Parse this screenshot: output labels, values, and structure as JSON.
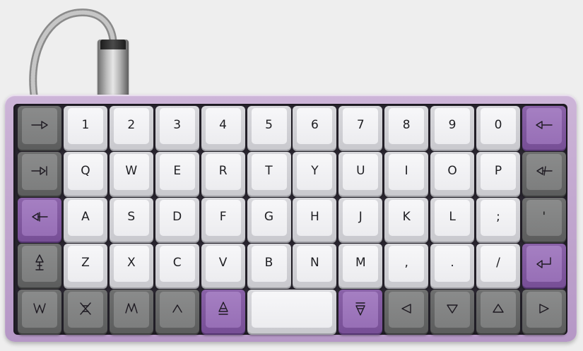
{
  "colors": {
    "case": "#c3a9d0",
    "alpha_keys": "#f2f2f4",
    "mod_keys": "#828383",
    "accent_keys": "#9c74ba",
    "cable": "#a8a8a8"
  },
  "keyboard": {
    "rows": [
      [
        {
          "label": "",
          "icon": "tab-right-arrow-icon",
          "color": "gray"
        },
        {
          "label": "1",
          "color": "white"
        },
        {
          "label": "2",
          "color": "white"
        },
        {
          "label": "3",
          "color": "white"
        },
        {
          "label": "4",
          "color": "white"
        },
        {
          "label": "5",
          "color": "white"
        },
        {
          "label": "6",
          "color": "white"
        },
        {
          "label": "7",
          "color": "white"
        },
        {
          "label": "8",
          "color": "white"
        },
        {
          "label": "9",
          "color": "white"
        },
        {
          "label": "0",
          "color": "white"
        },
        {
          "label": "",
          "icon": "backspace-arrow-icon",
          "color": "purple"
        }
      ],
      [
        {
          "label": "",
          "icon": "tab-key-icon",
          "color": "gray"
        },
        {
          "label": "Q",
          "color": "white"
        },
        {
          "label": "W",
          "color": "white"
        },
        {
          "label": "E",
          "color": "white"
        },
        {
          "label": "R",
          "color": "white"
        },
        {
          "label": "T",
          "color": "white"
        },
        {
          "label": "Y",
          "color": "white"
        },
        {
          "label": "U",
          "color": "white"
        },
        {
          "label": "I",
          "color": "white"
        },
        {
          "label": "O",
          "color": "white"
        },
        {
          "label": "P",
          "color": "white"
        },
        {
          "label": "",
          "icon": "delete-arrow-icon",
          "color": "gray"
        }
      ],
      [
        {
          "label": "",
          "icon": "escape-arrow-icon",
          "color": "purple"
        },
        {
          "label": "A",
          "color": "white"
        },
        {
          "label": "S",
          "color": "white"
        },
        {
          "label": "D",
          "color": "white"
        },
        {
          "label": "F",
          "color": "white"
        },
        {
          "label": "G",
          "color": "white"
        },
        {
          "label": "H",
          "color": "white"
        },
        {
          "label": "J",
          "color": "white"
        },
        {
          "label": "K",
          "color": "white"
        },
        {
          "label": "L",
          "color": "white"
        },
        {
          "label": ";",
          "color": "white"
        },
        {
          "label": "'",
          "color": "gray"
        }
      ],
      [
        {
          "label": "",
          "icon": "shift-arrow-icon",
          "color": "gray"
        },
        {
          "label": "Z",
          "color": "white"
        },
        {
          "label": "X",
          "color": "white"
        },
        {
          "label": "C",
          "color": "white"
        },
        {
          "label": "V",
          "color": "white"
        },
        {
          "label": "B",
          "color": "white"
        },
        {
          "label": "N",
          "color": "white"
        },
        {
          "label": "M",
          "color": "white"
        },
        {
          "label": ",",
          "color": "white"
        },
        {
          "label": ".",
          "color": "white"
        },
        {
          "label": "/",
          "color": "white"
        },
        {
          "label": "",
          "icon": "enter-arrow-icon",
          "color": "purple"
        }
      ]
    ],
    "bottom_row": [
      {
        "label": "",
        "icon": "control-caret-icon",
        "color": "gray",
        "span": 1
      },
      {
        "label": "",
        "icon": "alt-double-caret-icon",
        "color": "gray",
        "span": 1
      },
      {
        "label": "",
        "icon": "gui-caret-icon",
        "color": "gray",
        "span": 1
      },
      {
        "label": "",
        "icon": "caret-up-icon",
        "color": "gray",
        "span": 1
      },
      {
        "label": "",
        "icon": "raise-triangle-icon",
        "color": "purple",
        "span": 1
      },
      {
        "label": "",
        "icon": "spacebar",
        "color": "white",
        "span": 2
      },
      {
        "label": "",
        "icon": "lower-triangle-icon",
        "color": "purple",
        "span": 1
      },
      {
        "label": "",
        "icon": "arrow-left-icon",
        "color": "gray",
        "span": 1
      },
      {
        "label": "",
        "icon": "arrow-down-icon",
        "color": "gray",
        "span": 1
      },
      {
        "label": "",
        "icon": "arrow-up-icon",
        "color": "gray",
        "span": 1
      },
      {
        "label": "",
        "icon": "arrow-right-icon",
        "color": "gray",
        "span": 1
      }
    ]
  }
}
